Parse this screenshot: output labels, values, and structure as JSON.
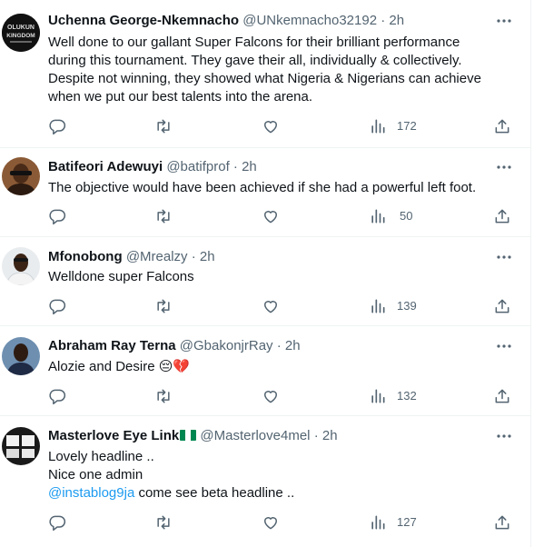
{
  "tweets": [
    {
      "name": "Uchenna George-Nkemnacho",
      "handle": "@UNkemnacho32192",
      "dot": "·",
      "time": "2h",
      "lines": [
        "Well done to our gallant Super Falcons for their brilliant performance",
        "during this tournament. They gave their all, individually & collectively.",
        "Despite not winning, they showed what Nigeria & Nigerians can achieve",
        "when we put our best talents into the arena."
      ],
      "views": "172",
      "avatar_text": [
        "OLUKUN",
        "KINGDOM"
      ]
    },
    {
      "name": "Batifeori Adewuyi",
      "handle": "@batifprof",
      "dot": "·",
      "time": "2h",
      "lines": [
        "The objective would have been achieved if she had a powerful left foot."
      ],
      "views": "50"
    },
    {
      "name": "Mfonobong",
      "handle": "@Mrealzy",
      "dot": "·",
      "time": "2h",
      "lines": [
        "Welldone super Falcons"
      ],
      "views": "139"
    },
    {
      "name": "Abraham Ray Terna",
      "handle": "@GbakonjrRay",
      "dot": "·",
      "time": "2h",
      "lines": [
        "Alozie and Desire"
      ],
      "emoji": [
        "😔",
        "💔"
      ],
      "views": "132"
    },
    {
      "name": "Masterlove Eye Link",
      "handle": "@Masterlove4mel",
      "dot": "·",
      "time": "2h",
      "lines": [
        "Lovely headline ..",
        "Nice one admin"
      ],
      "mention": "@instablog9ja",
      "mention_rest": " come see beta headline ..",
      "views": "127"
    }
  ],
  "colors": {
    "text": "#0f1419",
    "secondary": "#536471",
    "link": "#1d9bf0",
    "border": "#eff3f4",
    "flag_green": "#008751"
  },
  "icons": [
    "reply-icon",
    "retweet-icon",
    "like-icon",
    "views-icon",
    "share-icon",
    "more-icon"
  ]
}
